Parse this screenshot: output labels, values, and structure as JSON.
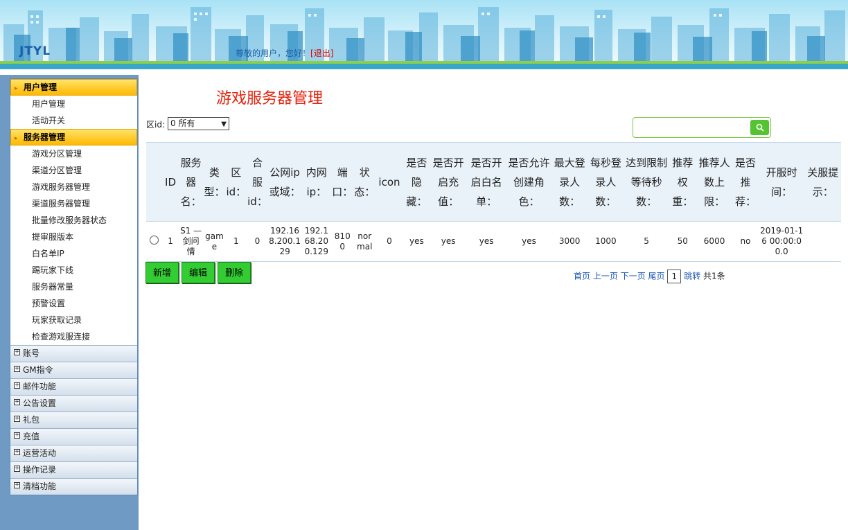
{
  "header": {
    "logo": "JTYL",
    "greeting": "尊敬的用户，您好！",
    "bracket_open": "[",
    "logout": "退出",
    "bracket_close": "]"
  },
  "sidebar": {
    "groups": [
      {
        "label": "用户管理",
        "items": [
          "用户管理",
          "活动开关"
        ]
      },
      {
        "label": "服务器管理",
        "items": [
          "游戏分区管理",
          "渠道分区管理",
          "游戏服务器管理",
          "渠道服务器管理",
          "批量修改服务器状态",
          "提审服版本",
          "白名单IP",
          "踢玩家下线",
          "服务器常量",
          "预警设置",
          "玩家获取记录",
          "检查游戏服连接"
        ]
      }
    ],
    "collapsed": [
      "账号",
      "GM指令",
      "邮件功能",
      "公告设置",
      "礼包",
      "充值",
      "运营活动",
      "操作记录",
      "清档功能"
    ]
  },
  "main": {
    "title": "游戏服务器管理",
    "zone_label": "区id:",
    "zone_select": "0 所有",
    "search_placeholder": ""
  },
  "table": {
    "headers": [
      "ID",
      "服务器名：",
      "类型：",
      "区id：",
      "合服id：",
      "公网ip或域：",
      "内网ip：",
      "端口：",
      "状态：",
      "icon",
      "是否隐藏：",
      "是否开启充值：",
      "是否开启白名单：",
      "是否允许创建角色：",
      "最大登录人数：",
      "每秒登录人数：",
      "达到限制等待秒数：",
      "推荐权重：",
      "推荐人数上限：",
      "是否推荐：",
      "开服时间：",
      "关服提示："
    ],
    "rows": [
      [
        "1",
        "S1 — 剑问情",
        "game",
        "1",
        "0",
        "192.168.200.129",
        "192.168.200.129",
        "8100",
        "normal",
        "0",
        "yes",
        "yes",
        "yes",
        "yes",
        "3000",
        "1000",
        "5",
        "50",
        "6000",
        "no",
        "2019-01-16 00:00:00.0",
        ""
      ]
    ]
  },
  "buttons": {
    "add": "新增",
    "edit": "编辑",
    "delete": "删除"
  },
  "pager": {
    "first": "首页",
    "prev": "上一页",
    "next": "下一页",
    "last": "尾页",
    "page": "1",
    "jump": "跳转",
    "total": "共1条"
  }
}
